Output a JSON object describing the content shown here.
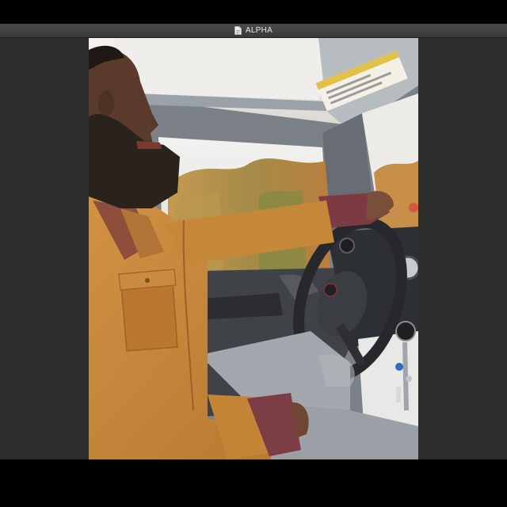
{
  "window": {
    "title": "ALPHA",
    "icon": "document-icon"
  },
  "photo": {
    "subject": "man-driving-jeep-photo",
    "colors": {
      "jacket": "#c7893f",
      "headliner": "#e9e7e2",
      "pillar": "#6d7378",
      "steering": "#2a2c2f",
      "jeans": "#9aa0a6",
      "foliage": "#c99a4a"
    }
  }
}
